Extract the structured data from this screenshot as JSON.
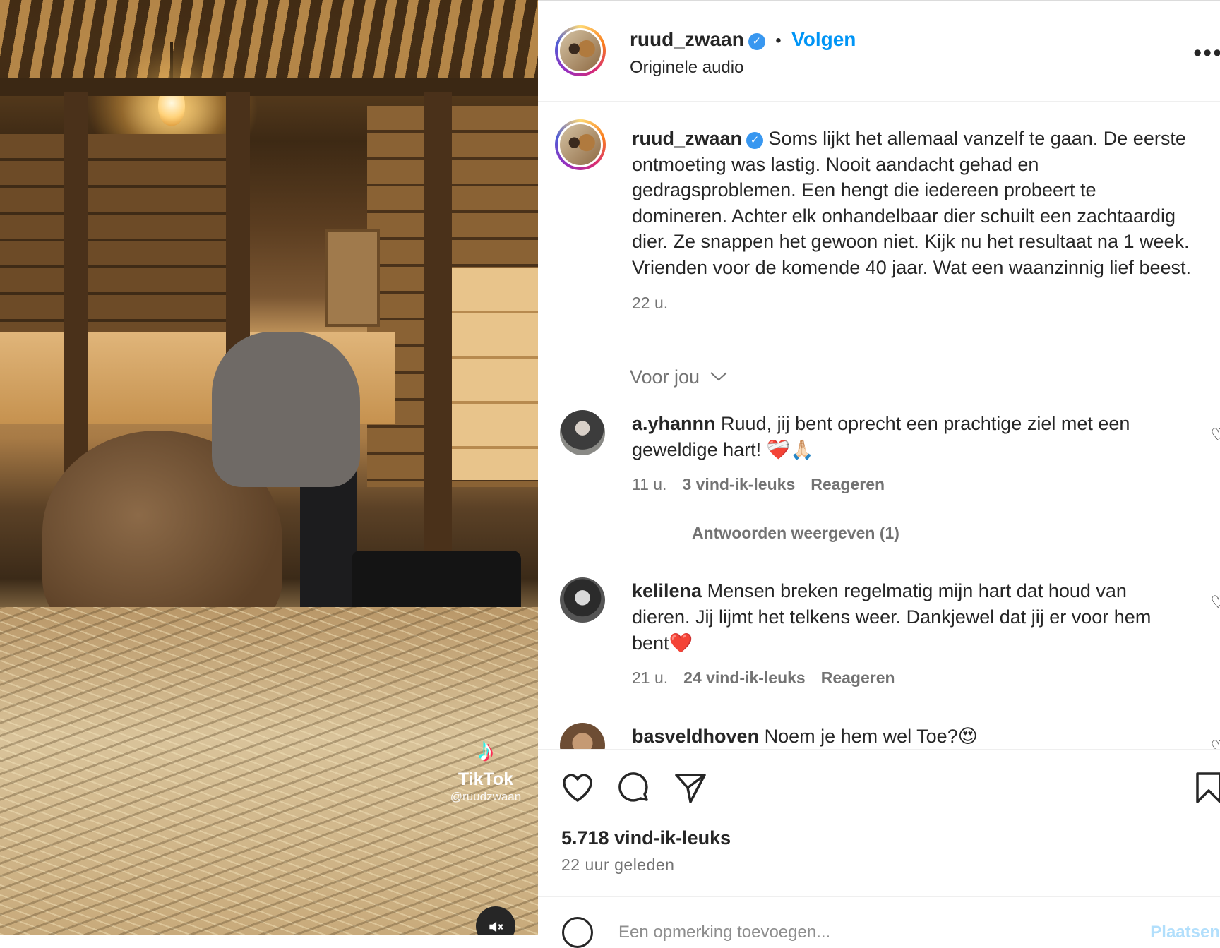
{
  "header": {
    "username": "ruud_zwaan",
    "separator": "•",
    "follow_label": "Volgen",
    "audio_label": "Originele audio",
    "more_icon": "more-horizontal-icon"
  },
  "caption": {
    "username": "ruud_zwaan",
    "text": "Soms lijkt het allemaal vanzelf te gaan. De eerste ontmoeting was lastig. Nooit aandacht gehad en gedragsproblemen. Een hengt die iedereen probeert te domineren. Achter elk onhandelbaar dier schuilt een zachtaardig dier. Ze snappen het gewoon niet. Kijk nu het resultaat na 1 week. Vrienden voor de komende 40 jaar. Wat een waanzinnig lief beest.",
    "time": "22 u."
  },
  "filter": {
    "label": "Voor jou"
  },
  "comments": [
    {
      "username": "a.yhannn",
      "text": "Ruud, jij bent oprecht een prachtige ziel met een geweldige hart! ❤️‍🩹🙏🏻",
      "time": "11 u.",
      "likes": "3 vind-ik-leuks",
      "reply": "Reageren",
      "view_replies": "Antwoorden weergeven (1)"
    },
    {
      "username": "kelilena",
      "text": "Mensen breken regelmatig mijn hart dat houd van dieren. Jij lijmt het telkens weer. Dankjewel dat jij er voor hem bent❤️",
      "time": "21 u.",
      "likes": "24 vind-ik-leuks",
      "reply": "Reageren"
    },
    {
      "username": "basveldhoven",
      "text": "Noem je hem wel Toe?😍"
    }
  ],
  "actions": {
    "likes": "5.718 vind-ik-leuks",
    "posted": "22 uur geleden"
  },
  "composer": {
    "placeholder": "Een opmerking toevoegen...",
    "post_label": "Plaatsen"
  },
  "media": {
    "tiktok_brand": "TikTok",
    "tiktok_handle": "@ruudzwaan",
    "mute_icon": "speaker-muted-icon"
  },
  "colors": {
    "accent": "#0095f6",
    "verified": "#3897f0",
    "muted_text": "#737373"
  }
}
